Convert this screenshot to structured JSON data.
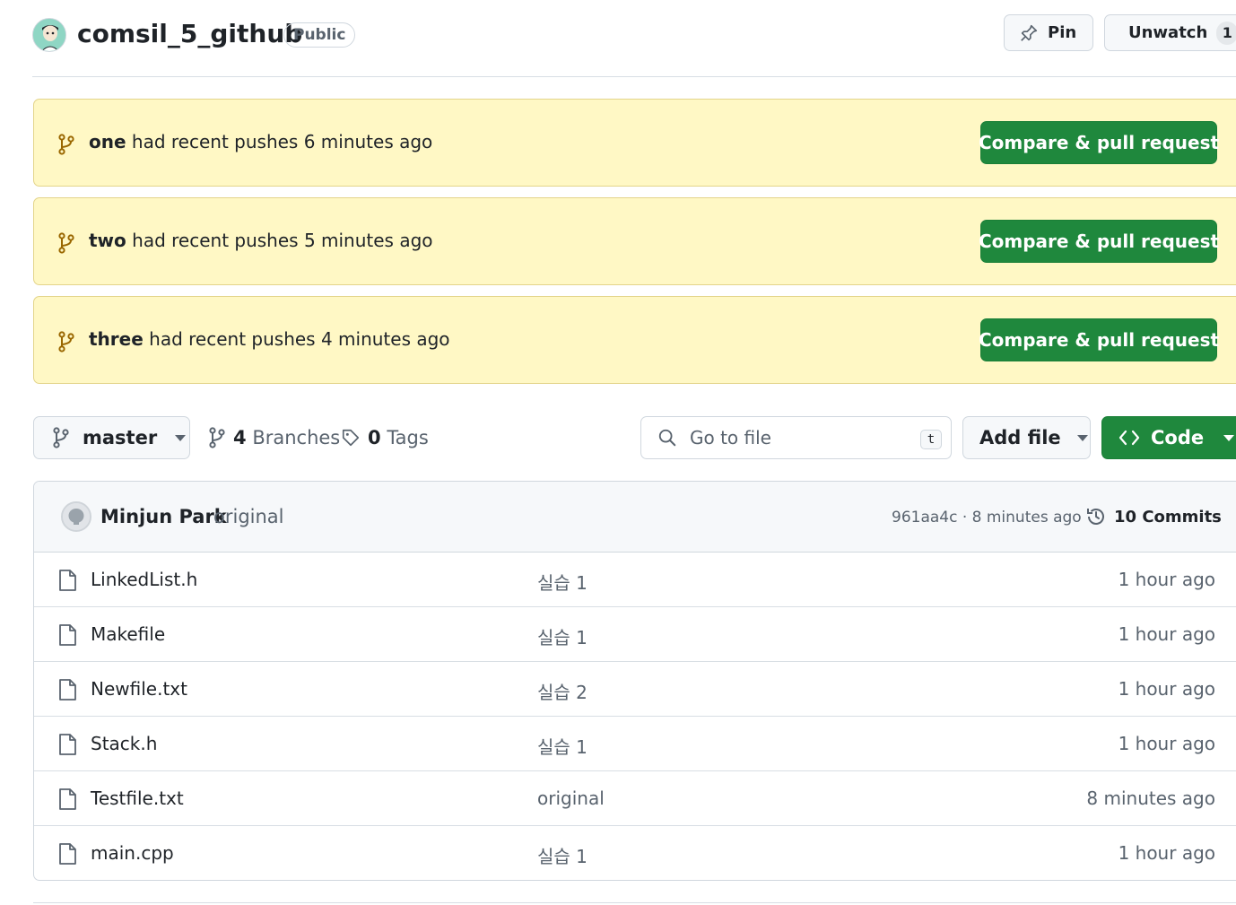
{
  "header": {
    "repo_name": "comsil_5_github",
    "visibility": "Public",
    "pin_label": "Pin",
    "unwatch_label": "Unwatch",
    "watch_count": "1"
  },
  "banners": [
    {
      "branch": "one",
      "text": "had recent pushes 6 minutes ago",
      "button": "Compare & pull request"
    },
    {
      "branch": "two",
      "text": "had recent pushes 5 minutes ago",
      "button": "Compare & pull request"
    },
    {
      "branch": "three",
      "text": "had recent pushes 4 minutes ago",
      "button": "Compare & pull request"
    }
  ],
  "toolbar": {
    "branch": "master",
    "branches_count": "4",
    "branches_label": "Branches",
    "tags_count": "0",
    "tags_label": "Tags",
    "search_placeholder": "Go to file",
    "search_shortcut": "t",
    "add_file_label": "Add file",
    "code_label": "Code"
  },
  "latest_commit": {
    "author": "Minjun Park",
    "message": "original",
    "hash_time": "961aa4c · 8 minutes ago",
    "commits_label": "10 Commits"
  },
  "files": [
    {
      "name": "LinkedList.h",
      "message": "실습 1",
      "time": "1 hour ago"
    },
    {
      "name": "Makefile",
      "message": "실습 1",
      "time": "1 hour ago"
    },
    {
      "name": "Newfile.txt",
      "message": "실습 2",
      "time": "1 hour ago"
    },
    {
      "name": "Stack.h",
      "message": "실습 1",
      "time": "1 hour ago"
    },
    {
      "name": "Testfile.txt",
      "message": "original",
      "time": "8 minutes ago"
    },
    {
      "name": "main.cpp",
      "message": "실습 1",
      "time": "1 hour ago"
    }
  ],
  "colors": {
    "green": "#1f883d",
    "banner_bg": "#fff8c5",
    "muted_text": "#59636e",
    "branch_icon": "#9a6700"
  }
}
